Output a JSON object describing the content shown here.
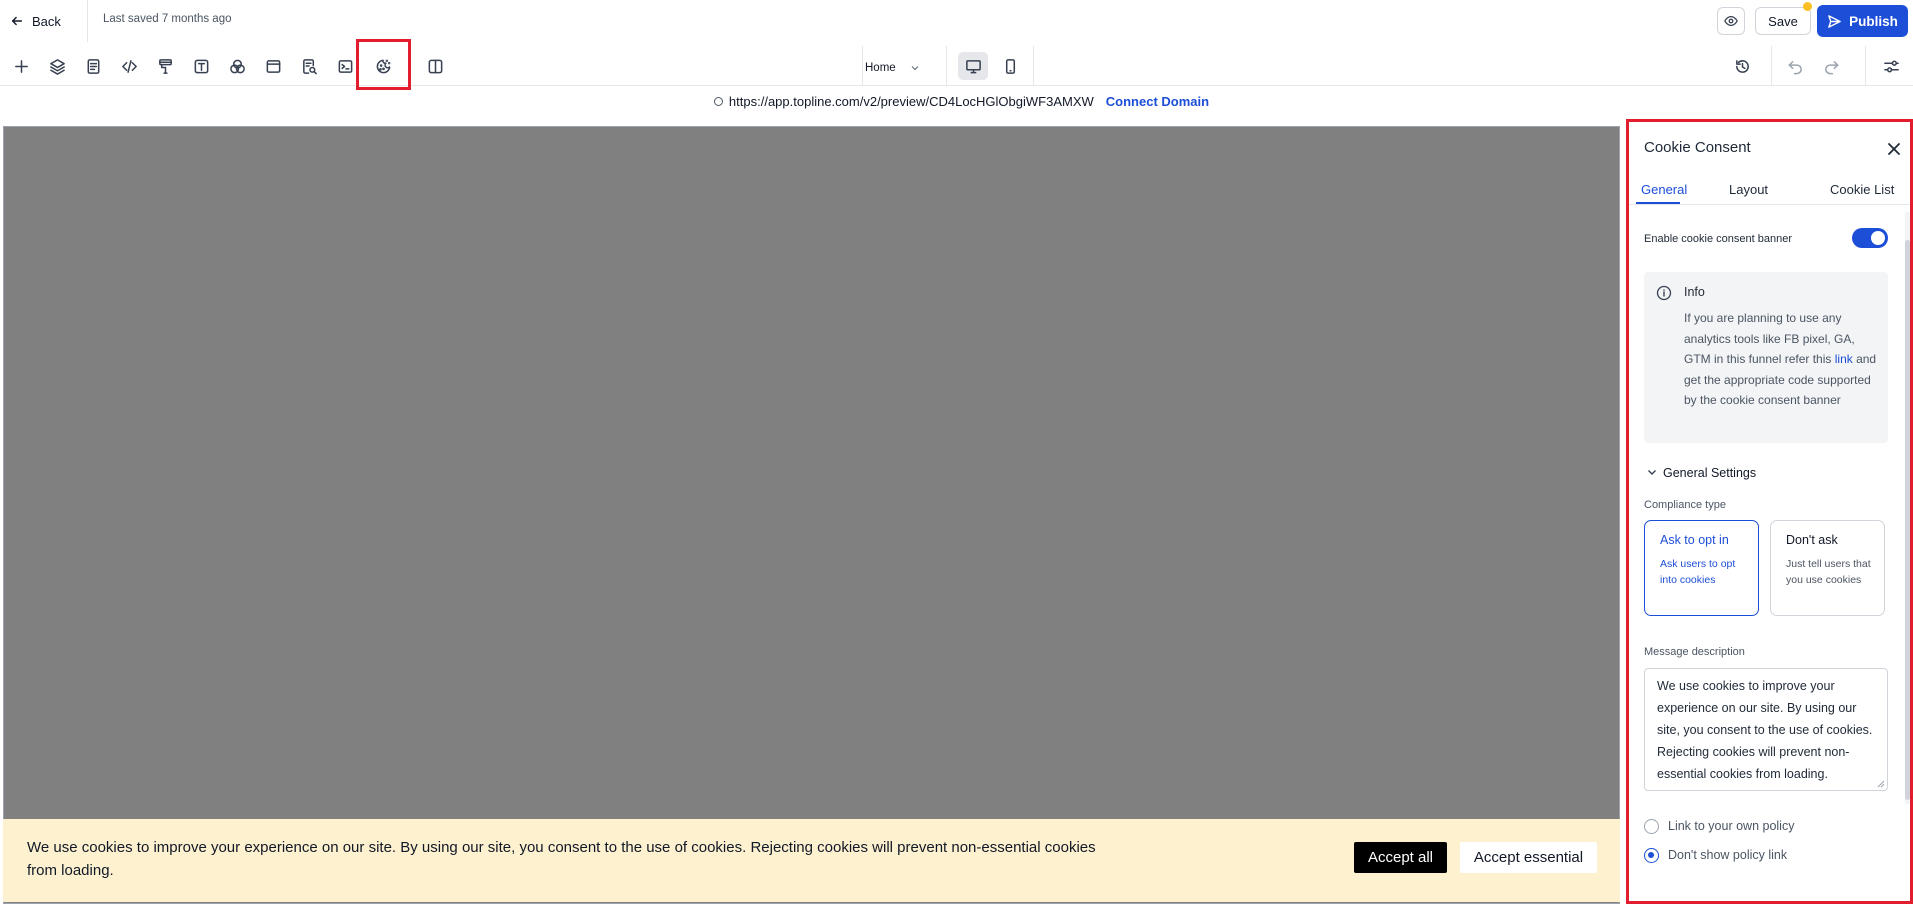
{
  "topbar": {
    "back_label": "Back",
    "last_saved": "Last saved 7 months ago",
    "save_label": "Save",
    "publish_label": "Publish"
  },
  "toolbar": {
    "tools": [
      "add-icon",
      "layers-icon",
      "pages-icon",
      "code-icon",
      "paint-roller-icon",
      "text-icon",
      "color-palette-icon",
      "browser-window-icon",
      "page-search-icon",
      "terminal-icon",
      "cookie-icon",
      "columns-icon"
    ],
    "page_selector": "Home",
    "devices": [
      "desktop-icon",
      "mobile-icon"
    ]
  },
  "url": {
    "address": "https://app.topline.com/v2/preview/CD4LocHGlObgiWF3AMXW",
    "connect_label": "Connect Domain"
  },
  "banner": {
    "text": "We use cookies to improve your experience on our site. By using our site, you consent to the use of cookies. Rejecting cookies will prevent non-essential cookies from loading.",
    "accept_all": "Accept all",
    "accept_essential": "Accept essential",
    "background": "#fdf1cf"
  },
  "panel": {
    "title": "Cookie Consent",
    "tabs": [
      "General",
      "Layout",
      "Cookie List"
    ],
    "active_tab": "General",
    "enable_label": "Enable cookie consent banner",
    "enabled": true,
    "info": {
      "title": "Info",
      "text_before": "If you are planning to use any analytics tools like FB pixel, GA, GTM in this funnel refer this ",
      "link": "link",
      "text_after": " and get the appropriate code supported by the cookie consent banner"
    },
    "general_settings_title": "General Settings",
    "compliance_label": "Compliance type",
    "options": [
      {
        "title": "Ask to opt in",
        "desc": "Ask users to opt into cookies",
        "selected": true
      },
      {
        "title": "Don't ask",
        "desc": "Just tell users that you use cookies",
        "selected": false
      }
    ],
    "message_label": "Message description",
    "message": "We use cookies to improve your experience on our site. By using our site, you consent to the use of cookies. Rejecting cookies will prevent non-essential cookies from loading.",
    "policy_options": [
      {
        "label": "Link to your own policy",
        "checked": false
      },
      {
        "label": "Don't show policy link",
        "checked": true
      }
    ]
  },
  "colors": {
    "accent": "#1d4ed8",
    "highlight": "#e11d2e",
    "canvas": "#808080"
  }
}
